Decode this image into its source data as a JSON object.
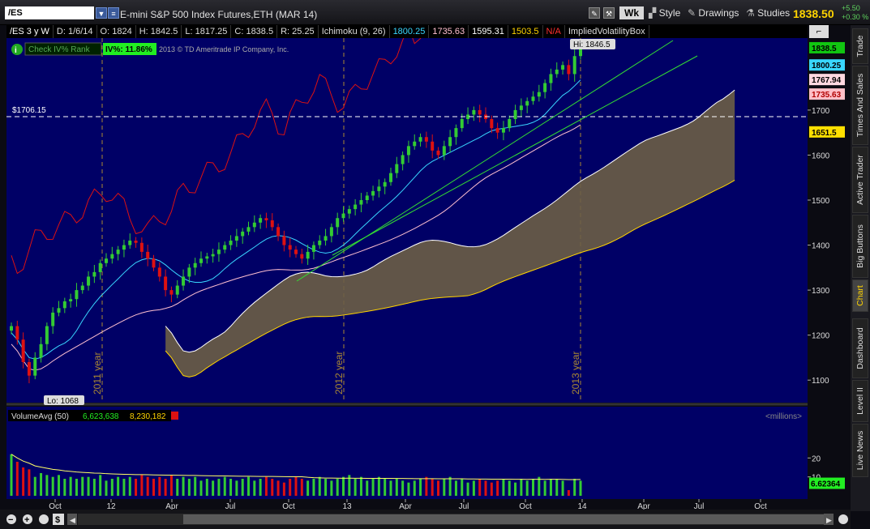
{
  "toolbar": {
    "symbol": "/ES",
    "title": "E-mini S&P 500 Index Futures,ETH (MAR 14)",
    "period": "Wk",
    "style_label": "Style",
    "drawings_label": "Drawings",
    "studies_label": "Studies",
    "last_price": "1838.50",
    "change_abs": "+5.50",
    "change_pct": "+0.30 %"
  },
  "info_bar": [
    "/ES 3 y W",
    "D: 1/6/14",
    "O: 1824",
    "H: 1842.5",
    "L: 1817.25",
    "C: 1838.5",
    "R: 25.25",
    "Ichimoku (9, 26)",
    "1800.25",
    "1735.63",
    "1595.31",
    "1503.5",
    "N/A",
    "ImpliedVolatilityBox"
  ],
  "overlay": {
    "check_text": "Check IV% Rank",
    "iv_label": "IV%: 11.86%",
    "copyright": "2013 © TD Ameritrade IP Company, Inc.",
    "hi_label": "Hi: 1846.5",
    "lo_label": "Lo: 1068",
    "hline_label": "$1706.15",
    "year_labels": [
      "2011 year",
      "2012 year",
      "2013 year"
    ]
  },
  "price_axis": {
    "ticks": [
      "1100",
      "1200",
      "1300",
      "1400",
      "1500",
      "1600",
      "1700"
    ],
    "badges": [
      {
        "text": "1838.5",
        "bg": "#11c611",
        "fg": "#000000",
        "value": 1838.5
      },
      {
        "text": "1800.25",
        "bg": "#39d6ff",
        "fg": "#000000",
        "value": 1800.25
      },
      {
        "text": "1767.94",
        "bg": "#ffd8e0",
        "fg": "#000000",
        "value": 1767.94
      },
      {
        "text": "1735.63",
        "bg": "#ffc0c8",
        "fg": "#b00000",
        "value": 1735.63
      },
      {
        "text": "1651.5",
        "bg": "#ffe000",
        "fg": "#000000",
        "value": 1651.5
      }
    ]
  },
  "volume": {
    "label": "VolumeAvg (50)",
    "v1": "6,623,638",
    "v2": "8,230,182",
    "units": "<millions>",
    "ticks": [
      "20",
      "10"
    ],
    "badge": "6.62364"
  },
  "time_axis": [
    "Oct",
    "12",
    "Apr",
    "Jul",
    "Oct",
    "13",
    "Apr",
    "Jul",
    "Oct",
    "14",
    "Apr",
    "Jul",
    "Oct"
  ],
  "side_tabs": [
    "Trade",
    "Times And Sales",
    "Active Trader",
    "Big Buttons",
    "Chart",
    "Dashboard",
    "Level II",
    "Live News"
  ],
  "colors": {
    "bg": "#000066",
    "up": "#33cc33",
    "down": "#dd1111",
    "accent": "#ffd400"
  },
  "chart_data": {
    "type": "candlestick",
    "interval": "weekly",
    "price_range": [
      1050,
      1860
    ],
    "close": [
      1220,
      1190,
      1140,
      1110,
      1150,
      1180,
      1220,
      1250,
      1260,
      1275,
      1280,
      1300,
      1310,
      1330,
      1340,
      1360,
      1370,
      1380,
      1390,
      1400,
      1410,
      1405,
      1385,
      1370,
      1350,
      1330,
      1300,
      1290,
      1310,
      1330,
      1350,
      1360,
      1370,
      1375,
      1380,
      1390,
      1400,
      1410,
      1420,
      1430,
      1440,
      1450,
      1460,
      1455,
      1440,
      1420,
      1400,
      1390,
      1380,
      1370,
      1385,
      1400,
      1410,
      1420,
      1440,
      1460,
      1470,
      1480,
      1490,
      1500,
      1510,
      1520,
      1530,
      1540,
      1560,
      1580,
      1600,
      1620,
      1630,
      1640,
      1630,
      1610,
      1600,
      1620,
      1640,
      1660,
      1680,
      1690,
      1700,
      1690,
      1680,
      1660,
      1650,
      1660,
      1680,
      1700,
      1710,
      1720,
      1730,
      1740,
      1760,
      1780,
      1790,
      1800,
      1780,
      1820,
      1838.5
    ],
    "volume_millions": [
      22,
      18,
      15,
      14,
      10,
      12,
      11,
      10,
      11,
      9,
      10,
      9,
      10,
      10,
      9,
      11,
      8,
      9,
      10,
      9,
      10,
      9,
      11,
      10,
      9,
      10,
      9,
      11,
      9,
      10,
      9,
      10,
      8,
      9,
      8,
      9,
      10,
      9,
      8,
      9,
      10,
      8,
      9,
      10,
      9,
      8,
      7,
      9,
      10,
      9,
      8,
      9,
      10,
      9,
      8,
      9,
      10,
      11,
      9,
      10,
      8,
      9,
      10,
      9,
      8,
      9,
      8,
      7,
      8,
      9,
      10,
      9,
      8,
      9,
      10,
      8,
      9,
      7,
      8,
      9,
      8,
      7,
      8,
      9,
      8,
      7,
      9,
      8,
      9,
      10,
      8,
      9,
      9,
      8,
      3,
      9,
      8
    ]
  }
}
